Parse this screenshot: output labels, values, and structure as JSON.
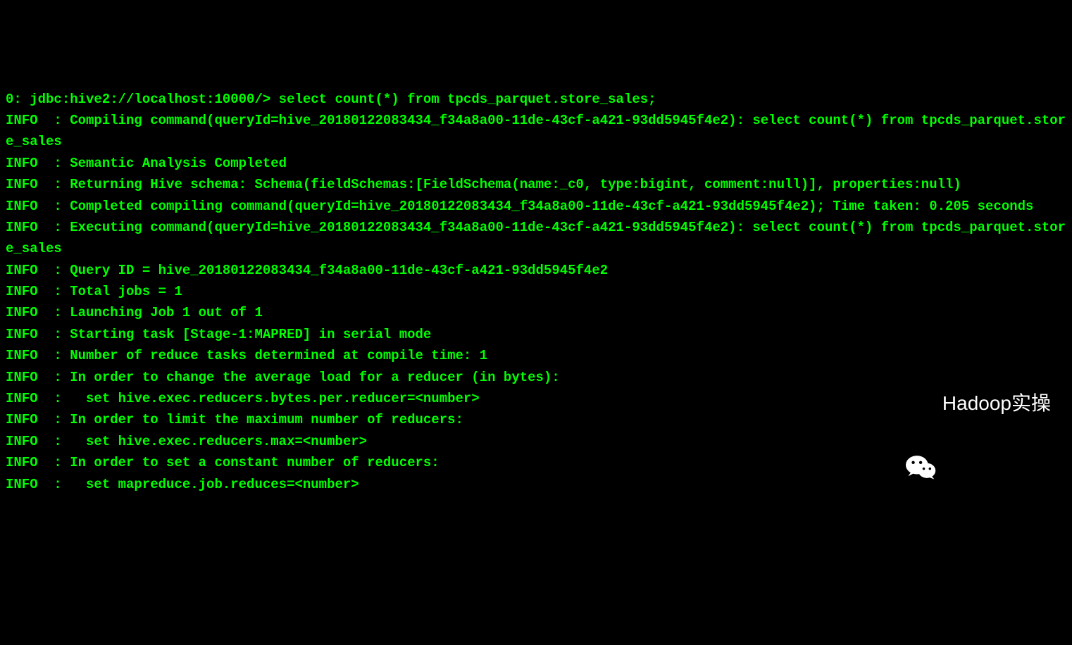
{
  "terminal": {
    "prompt": "0: jdbc:hive2://localhost:10000/>",
    "command": "select count(*) from tpcds_parquet.store_sales;",
    "lines": [
      "INFO  : Compiling command(queryId=hive_20180122083434_f34a8a00-11de-43cf-a421-93dd5945f4e2): select count(*) from tpcds_parquet.store_sales",
      "INFO  : Semantic Analysis Completed",
      "INFO  : Returning Hive schema: Schema(fieldSchemas:[FieldSchema(name:_c0, type:bigint, comment:null)], properties:null)",
      "INFO  : Completed compiling command(queryId=hive_20180122083434_f34a8a00-11de-43cf-a421-93dd5945f4e2); Time taken: 0.205 seconds",
      "INFO  : Executing command(queryId=hive_20180122083434_f34a8a00-11de-43cf-a421-93dd5945f4e2): select count(*) from tpcds_parquet.store_sales",
      "INFO  : Query ID = hive_20180122083434_f34a8a00-11de-43cf-a421-93dd5945f4e2",
      "INFO  : Total jobs = 1",
      "INFO  : Launching Job 1 out of 1",
      "INFO  : Starting task [Stage-1:MAPRED] in serial mode",
      "INFO  : Number of reduce tasks determined at compile time: 1",
      "INFO  : In order to change the average load for a reducer (in bytes):",
      "INFO  :   set hive.exec.reducers.bytes.per.reducer=<number>",
      "INFO  : In order to limit the maximum number of reducers:",
      "INFO  :   set hive.exec.reducers.max=<number>",
      "INFO  : In order to set a constant number of reducers:",
      "INFO  :   set mapreduce.job.reduces=<number>"
    ]
  },
  "watermark": {
    "text": "Hadoop实操"
  }
}
